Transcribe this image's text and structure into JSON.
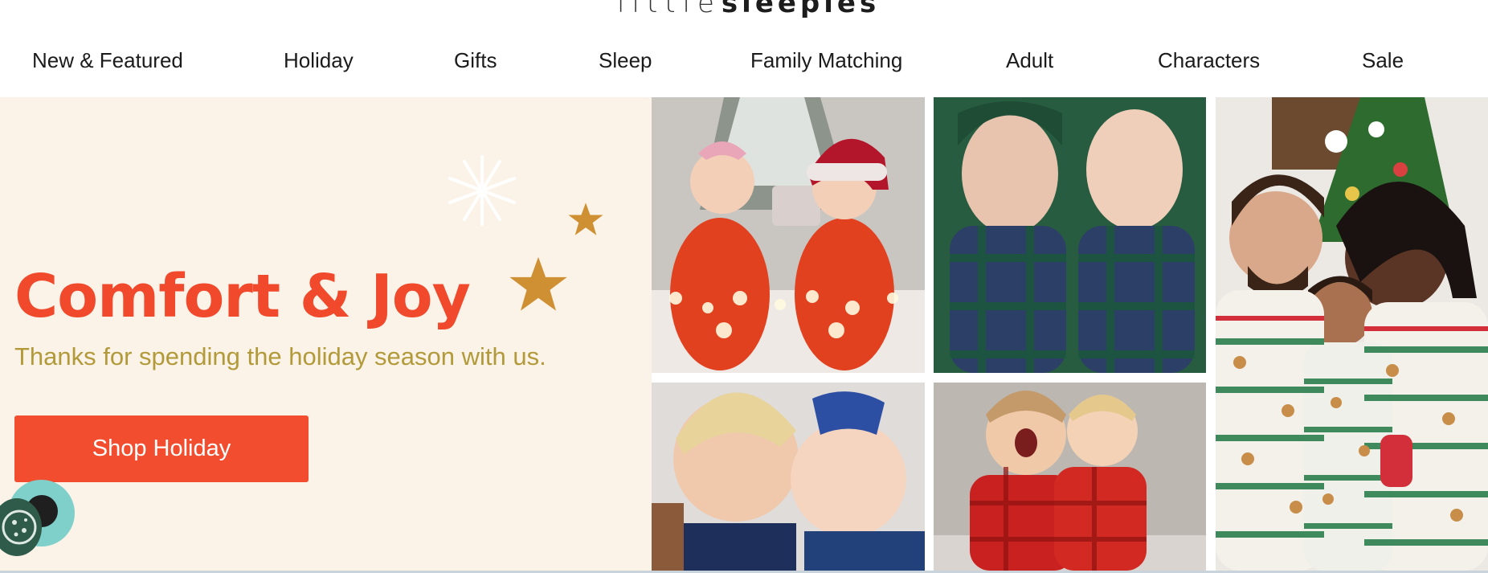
{
  "brand": {
    "logo_light": "little",
    "logo_bold": "sleepies"
  },
  "nav": {
    "items": [
      {
        "label": "New & Featured"
      },
      {
        "label": "Holiday"
      },
      {
        "label": "Gifts"
      },
      {
        "label": "Sleep"
      },
      {
        "label": "Family Matching"
      },
      {
        "label": "Adult"
      },
      {
        "label": "Characters"
      },
      {
        "label": "Sale"
      }
    ]
  },
  "hero": {
    "title": "Comfort & Joy",
    "subtitle": "Thanks for spending the holiday season with us.",
    "cta_label": "Shop Holiday"
  },
  "colors": {
    "accent": "#f0492c",
    "subtitle": "#b29a3a",
    "hero_bg": "#fbf3e8",
    "star": "#cf9034",
    "chat": "#7fd0cb",
    "cookie": "#2e5b4a"
  },
  "widgets": {
    "chat_icon": "chat-bubble-icon",
    "cookie_icon": "cookie-icon"
  }
}
